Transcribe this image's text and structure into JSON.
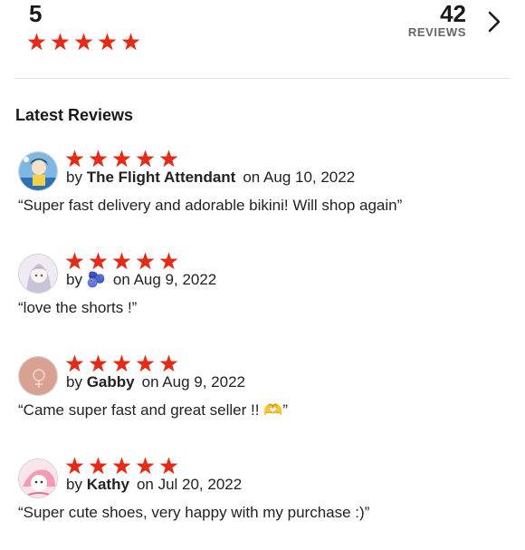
{
  "summary": {
    "rating": "5",
    "stars": 5,
    "review_count": "42",
    "review_count_label": "REVIEWS"
  },
  "section_title": "Latest Reviews",
  "reviews": [
    {
      "stars": 5,
      "by": "by",
      "author": "The Flight Attendant",
      "date": "on Aug 10, 2022",
      "text": "“Super fast delivery and adorable bikini! Will shop again”"
    },
    {
      "stars": 5,
      "by": "by",
      "author": "🫐",
      "date": "on Aug 9, 2022",
      "text": "“love the shorts !”"
    },
    {
      "stars": 5,
      "by": "by",
      "author": "Gabby",
      "date": "on Aug 9, 2022",
      "text": "“Came super fast and great seller !! 🫶”"
    },
    {
      "stars": 5,
      "by": "by",
      "author": "Kathy",
      "date": "on Jul 20, 2022",
      "text": "“Super cute shoes, very happy with my purchase :)”"
    }
  ],
  "colors": {
    "star": "#e32b17",
    "divider": "#e3e3e3"
  },
  "icons": {
    "next": "chevron-right-icon",
    "star": "star-icon"
  }
}
